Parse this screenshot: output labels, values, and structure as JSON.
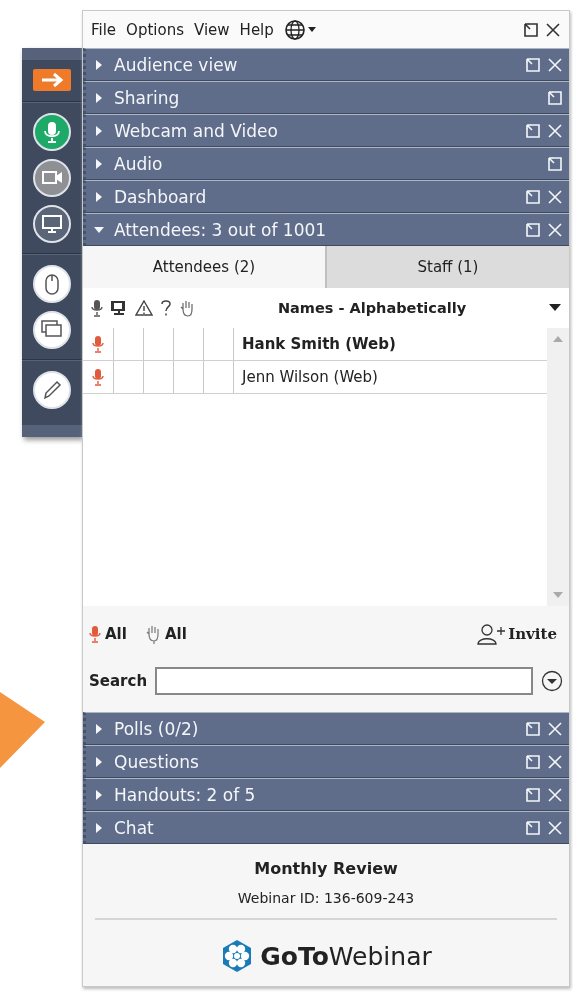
{
  "menu": [
    "File",
    "Options",
    "View",
    "Help"
  ],
  "sections": [
    {
      "title": "Audience view",
      "expanded": false,
      "closable": true
    },
    {
      "title": "Sharing",
      "expanded": false,
      "closable": false
    },
    {
      "title": "Webcam and Video",
      "expanded": false,
      "closable": true
    },
    {
      "title": "Audio",
      "expanded": false,
      "closable": false
    },
    {
      "title": "Dashboard",
      "expanded": false,
      "closable": true
    },
    {
      "title": "Attendees:  3 out of 1001",
      "expanded": true,
      "closable": true
    }
  ],
  "attendees": {
    "tabs": [
      {
        "label": "Attendees (2)",
        "selected": true
      },
      {
        "label": "Staff (1)",
        "selected": false
      }
    ],
    "sort": "Names - Alphabetically",
    "rows": [
      {
        "name": "Hank Smith (Web)",
        "muted": true
      },
      {
        "name": "Jenn Wilson (Web)",
        "muted": true
      }
    ],
    "actions": [
      {
        "kind": "mic",
        "label": "All"
      },
      {
        "kind": "hand",
        "label": "All"
      }
    ],
    "invite": "Invite",
    "search_label": "Search"
  },
  "bottom_sections": [
    {
      "title": "Polls (0/2)",
      "expanded": false,
      "closable": true
    },
    {
      "title": "Questions",
      "expanded": false,
      "closable": true
    },
    {
      "title": "Handouts: 2 of 5",
      "expanded": false,
      "closable": true
    },
    {
      "title": "Chat",
      "expanded": false,
      "closable": true
    }
  ],
  "footer": {
    "title": "Monthly Review",
    "webinar_id": "Webinar ID: 136-609-243",
    "logo": "**GoTo**Webinar"
  }
}
